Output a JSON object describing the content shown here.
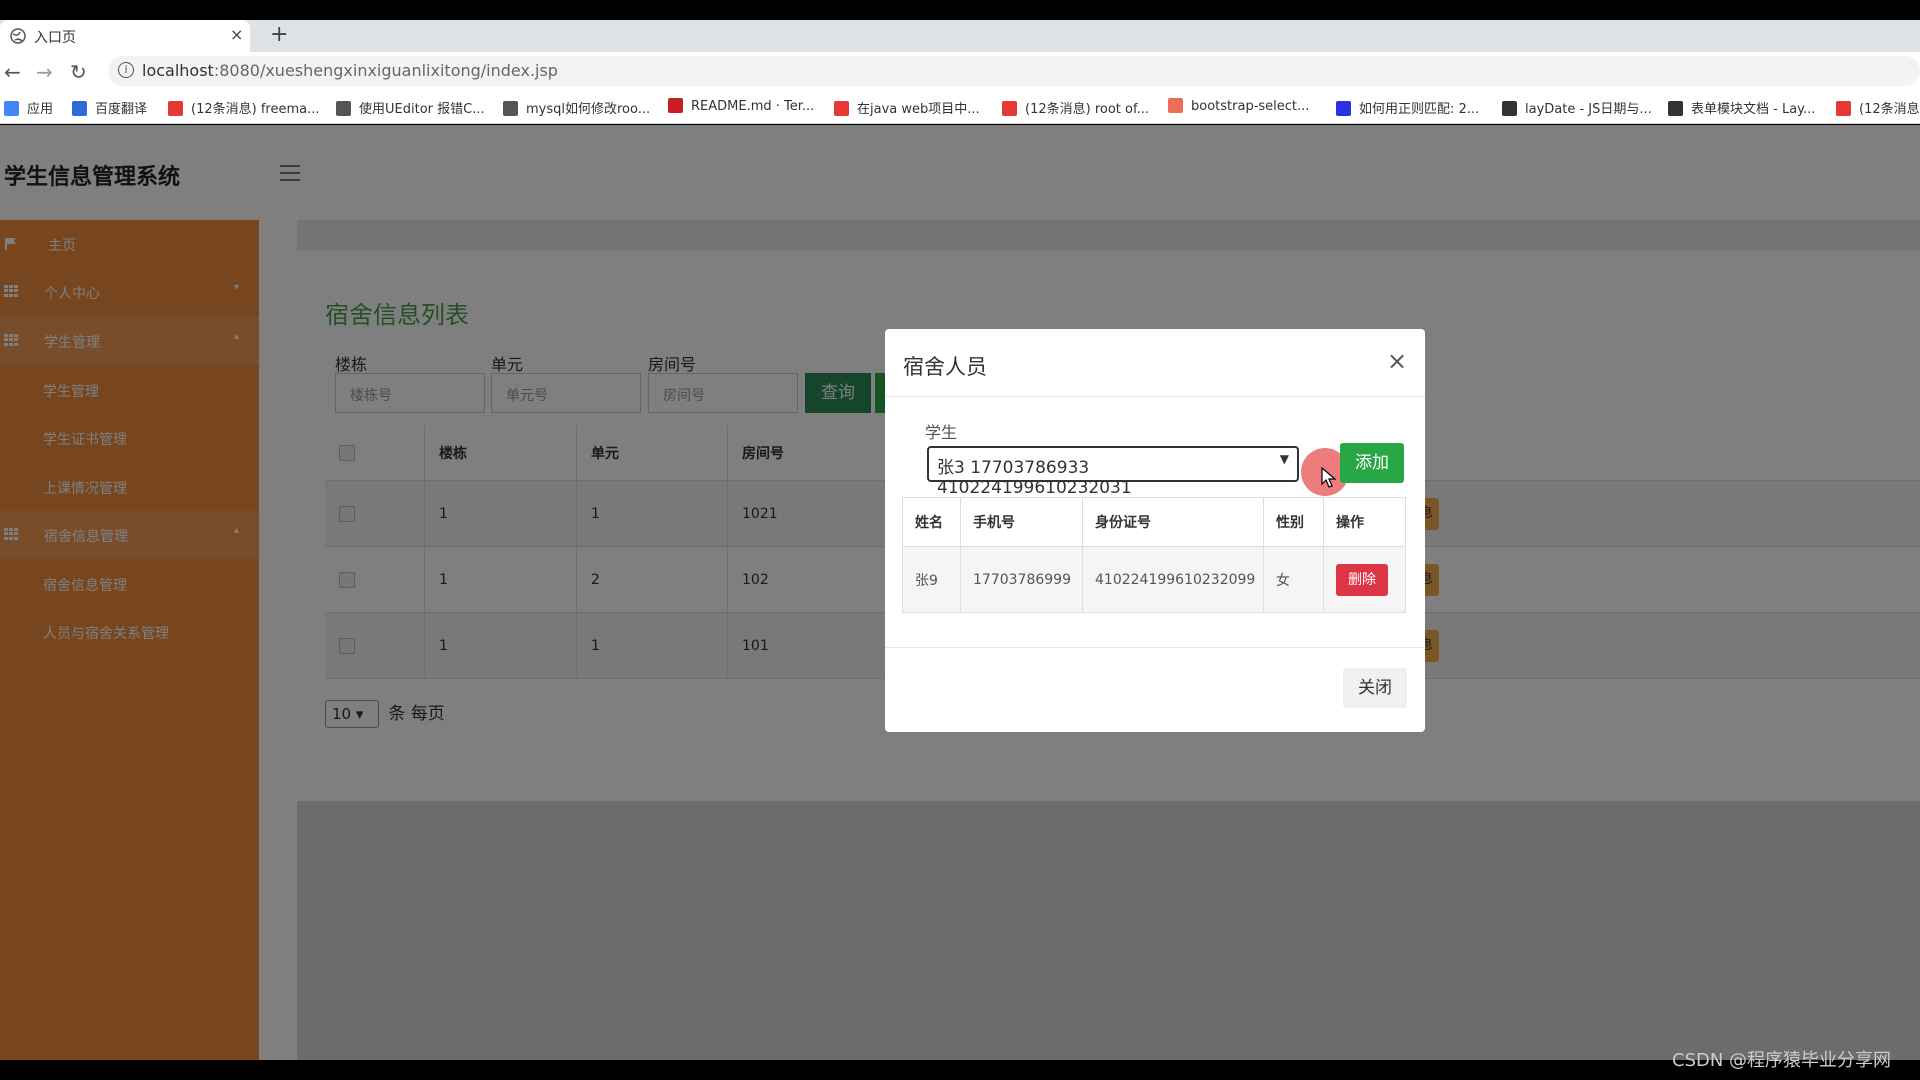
{
  "browser": {
    "tab_title": "入口页",
    "tab_close": "×",
    "new_tab": "+",
    "url_host": "localhost",
    "url_rest": ":8080/xueshengxinxiguanlixitong/index.jsp",
    "bookmarks": [
      {
        "label": "应用",
        "icon": "apps-grid-icon",
        "color": "#4285f4"
      },
      {
        "label": "百度翻译",
        "icon": "baidu-translate-icon",
        "color": "#2d6ad8"
      },
      {
        "label": "(12条消息) freema...",
        "icon": "csdn-icon",
        "color": "#e53935"
      },
      {
        "label": "使用UEditor 报错C...",
        "icon": "ueditor-icon",
        "color": "#555555"
      },
      {
        "label": "mysql如何修改roo...",
        "icon": "mysql-icon",
        "color": "#555555"
      },
      {
        "label": "README.md · Ter...",
        "icon": "gitee-icon",
        "color": "#c71d23"
      },
      {
        "label": "在java web项目中...",
        "icon": "csdn-icon",
        "color": "#e53935"
      },
      {
        "label": "(12条消息) root of...",
        "icon": "csdn-icon",
        "color": "#e53935"
      },
      {
        "label": "bootstrap-select...",
        "icon": "jianshu-icon",
        "color": "#ea6f5a"
      },
      {
        "label": "如何用正则匹配: 2...",
        "icon": "baidu-paw-icon",
        "color": "#2932e1"
      },
      {
        "label": "layDate - JS日期与...",
        "icon": "layui-icon",
        "color": "#333333"
      },
      {
        "label": "表单模块文档 - Lay...",
        "icon": "layui-icon",
        "color": "#333333"
      },
      {
        "label": "(12条消息",
        "icon": "csdn-icon",
        "color": "#e53935"
      }
    ]
  },
  "app": {
    "brand": "学生信息管理系统",
    "accent": "#ef8a3c",
    "sidebar": [
      {
        "label": "主页",
        "type": "top",
        "icon": "flag-icon"
      },
      {
        "label": "个人中心",
        "type": "group",
        "icon": "grid-icon",
        "caret": "▾"
      },
      {
        "label": "学生管理",
        "type": "group-open",
        "icon": "grid-icon",
        "caret": "▴"
      },
      {
        "label": "学生管理",
        "type": "sub"
      },
      {
        "label": "学生证书管理",
        "type": "sub"
      },
      {
        "label": "上课情况管理",
        "type": "sub"
      },
      {
        "label": "宿舍信息管理",
        "type": "group-open",
        "icon": "grid-icon",
        "caret": "▴"
      },
      {
        "label": "宿舍信息管理",
        "type": "sub"
      },
      {
        "label": "人员与宿舍关系管理",
        "type": "sub"
      }
    ],
    "panel": {
      "title": "宿舍信息列表",
      "filters": [
        {
          "label": "楼栋",
          "placeholder": "楼栋号"
        },
        {
          "label": "单元",
          "placeholder": "单元号"
        },
        {
          "label": "房间号",
          "placeholder": "房间号"
        }
      ],
      "query_button": "查询",
      "columns": [
        "",
        "楼栋",
        "单元",
        "房间号"
      ],
      "rows": [
        {
          "building": "1",
          "unit": "1",
          "room": "1021",
          "action": "息"
        },
        {
          "building": "1",
          "unit": "2",
          "room": "102",
          "action": "息"
        },
        {
          "building": "1",
          "unit": "1",
          "room": "101",
          "action": "息"
        }
      ],
      "page_size": "10",
      "page_size_suffix": "条 每页"
    }
  },
  "modal": {
    "title": "宿舍人员",
    "close_icon": "×",
    "field_label": "学生",
    "selected_student": "张3 17703786933 410224199610232031",
    "add_button": "添加",
    "columns": [
      "姓名",
      "手机号",
      "身份证号",
      "性别",
      "操作"
    ],
    "rows": [
      {
        "name": "张9",
        "phone": "17703786999",
        "id_card": "410224199610232099",
        "gender": "女",
        "action": "删除"
      }
    ],
    "close_button": "关闭"
  },
  "watermark": "CSDN @程序猿毕业分享网"
}
